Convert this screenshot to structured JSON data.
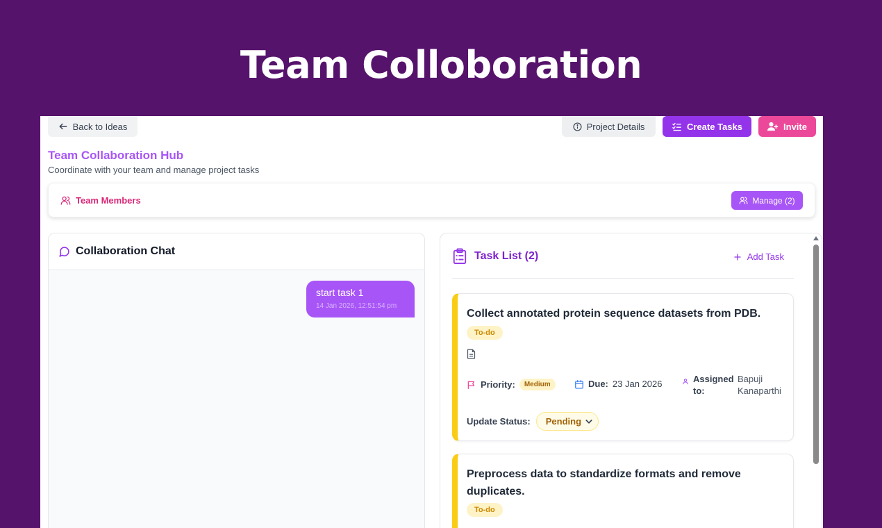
{
  "hero": {
    "title": "Team Colloboration"
  },
  "toolbar": {
    "back_label": "Back to Ideas",
    "project_details_label": "Project Details",
    "create_tasks_label": "Create Tasks",
    "invite_label": "Invite"
  },
  "hub": {
    "title": "Team Collaboration Hub",
    "subtitle": "Coordinate with your team and manage project tasks"
  },
  "members": {
    "label": "Team Members",
    "manage_label": "Manage (2)"
  },
  "chat": {
    "title": "Collaboration Chat",
    "messages": [
      {
        "text": "start task 1",
        "time": "14 Jan 2026, 12:51:54 pm"
      }
    ]
  },
  "tasks": {
    "title": "Task List (2)",
    "add_label": "Add Task",
    "priority_label": "Priority:",
    "due_label": "Due:",
    "assigned_label": "Assigned to:",
    "update_status_label": "Update Status:",
    "items": [
      {
        "title": "Collect annotated protein sequence datasets from PDB.",
        "status_badge": "To-do",
        "priority": "Medium",
        "due": "23 Jan 2026",
        "assignee": "Bapuji Kanaparthi",
        "status_value": "Pending"
      },
      {
        "title": "Preprocess data to standardize formats and remove duplicates.",
        "status_badge": "To-do"
      }
    ]
  },
  "colors": {
    "background": "#56136b",
    "primary_purple": "#9333ea",
    "invite_pink": "#ec4899",
    "todo_accent": "#facc15"
  }
}
